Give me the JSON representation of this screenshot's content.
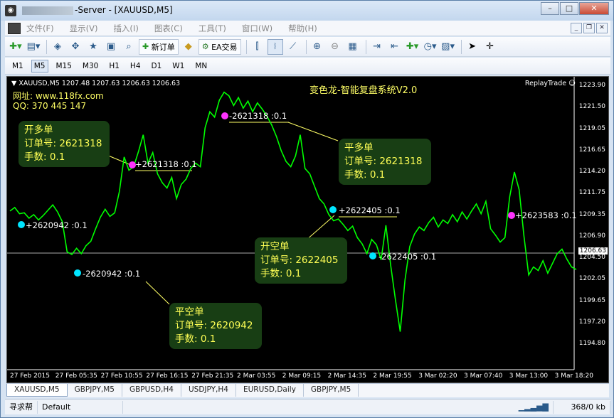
{
  "window": {
    "title": "-Server - [XAUUSD,M5]",
    "minimize": "–",
    "maximize": "□",
    "close": "✕"
  },
  "menu": {
    "items": [
      "文件(F)",
      "显示(V)",
      "插入(I)",
      "图表(C)",
      "工具(T)",
      "窗口(W)",
      "帮助(H)"
    ]
  },
  "toolbar": {
    "new_order": "新订单",
    "ea_trading": "EA交易"
  },
  "timeframes": [
    "M1",
    "M5",
    "M15",
    "M30",
    "H1",
    "H4",
    "D1",
    "W1",
    "MN"
  ],
  "timeframe_active": "M5",
  "chart": {
    "header": "▼ XAUUSD,M5  1207.48 1207.63 1206.63 1206.63",
    "title": "变色龙-智能复盘系统V2.0",
    "replay": "ReplayTrade ☺",
    "site": "网址: www.118fx.com",
    "qq": "QQ: 370 445 147",
    "current_price": "1206.63",
    "price_axis": [
      "1223.90",
      "1221.50",
      "1219.05",
      "1216.65",
      "1214.20",
      "1211.75",
      "1209.35",
      "1206.90",
      "1204.50",
      "1202.05",
      "1199.65",
      "1197.20",
      "1194.80"
    ],
    "time_axis": [
      "27 Feb 2015",
      "27 Feb 05:35",
      "27 Feb 10:55",
      "27 Feb 16:15",
      "27 Feb 21:35",
      "2 Mar 03:55",
      "2 Mar 09:15",
      "2 Mar 14:35",
      "2 Mar 19:55",
      "3 Mar 02:20",
      "3 Mar 07:40",
      "3 Mar 13:00",
      "3 Mar 18:20"
    ],
    "trade_labels": {
      "t1": "+2620942 :0.1",
      "t2": "-2620942 :0.1",
      "t3": "+2621318 :0.1",
      "t4": "-2621318 :0.1",
      "t5": "+2622405 :0.1",
      "t6": "-2622405 :0.1",
      "t7": "+2623583 :0.1"
    },
    "notes": {
      "open_long": {
        "title": "开多单",
        "order": "订单号: 2621318",
        "lots": "手数: 0.1"
      },
      "close_long": {
        "title": "平多单",
        "order": "订单号: 2621318",
        "lots": "手数: 0.1"
      },
      "open_short": {
        "title": "开空单",
        "order": "订单号: 2622405",
        "lots": "手数: 0.1"
      },
      "close_short": {
        "title": "平空单",
        "order": "订单号: 2620942",
        "lots": "手数: 0.1"
      }
    },
    "colors": {
      "price_line": "#00ff00",
      "buy_marker": "#00e5ff",
      "sell_marker": "#ff33ff",
      "note_text": "#ffff55"
    }
  },
  "chart_data": {
    "type": "line",
    "title": "变色龙-智能复盘系统V2.0",
    "ylim": [
      1194.8,
      1223.9
    ],
    "y": [
      1209.8,
      1210.2,
      1209.5,
      1209.6,
      1209.0,
      1209.4,
      1208.8,
      1209.3,
      1209.9,
      1210.5,
      1209.7,
      1208.6,
      1205.2,
      1204.9,
      1205.6,
      1205.0,
      1205.9,
      1206.4,
      1207.8,
      1209.1,
      1210.0,
      1209.2,
      1209.6,
      1212.0,
      1215.9,
      1214.4,
      1214.8,
      1216.5,
      1218.4,
      1215.2,
      1216.4,
      1214.0,
      1213.0,
      1212.4,
      1213.6,
      1211.2,
      1212.8,
      1213.4,
      1214.6,
      1215.2,
      1214.8,
      1219.2,
      1221.0,
      1220.4,
      1222.3,
      1223.2,
      1222.8,
      1221.7,
      1222.6,
      1221.4,
      1222.2,
      1221.0,
      1222.0,
      1221.3,
      1220.5,
      1219.5,
      1218.2,
      1216.6,
      1215.4,
      1214.8,
      1216.0,
      1218.4,
      1214.6,
      1214.0,
      1212.6,
      1211.2,
      1210.6,
      1209.4,
      1208.7,
      1208.9,
      1208.3,
      1207.6,
      1208.1,
      1206.8,
      1206.1,
      1205.0,
      1206.6,
      1206.0,
      1204.3,
      1208.2,
      1203.7,
      1199.8,
      1196.2,
      1202.0,
      1205.8,
      1207.2,
      1208.0,
      1207.6,
      1208.5,
      1209.1,
      1208.0,
      1208.8,
      1208.4,
      1209.4,
      1208.6,
      1209.7,
      1208.9,
      1209.8,
      1210.6,
      1209.5,
      1210.9,
      1207.8,
      1207.1,
      1206.3,
      1206.8,
      1211.4,
      1214.2,
      1212.2,
      1207.0,
      1202.6,
      1203.5,
      1203.1,
      1204.2,
      1202.8,
      1203.9,
      1205.0,
      1205.5,
      1204.4,
      1203.5,
      1203.2
    ]
  }
}
